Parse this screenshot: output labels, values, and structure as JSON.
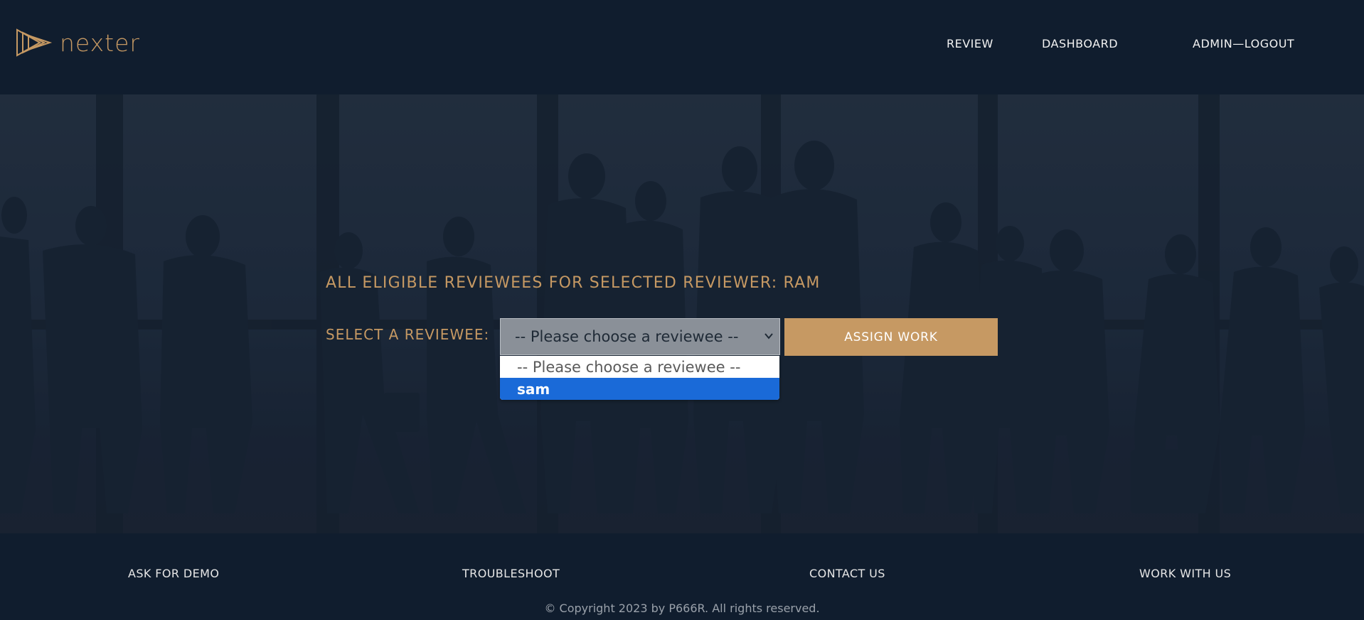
{
  "header": {
    "brand": "nexter",
    "nav": [
      {
        "label": "REVIEW"
      },
      {
        "label": "DASHBOARD"
      },
      {
        "label": "ADMIN—LOGOUT"
      }
    ]
  },
  "main": {
    "title": "ALL ELIGIBLE REVIEWEES FOR SELECTED REVIEWER: RAM",
    "select_label": "SELECT A REVIEWEE:",
    "select": {
      "value": "-- Please choose a reviewee --",
      "options": [
        {
          "label": "-- Please choose a reviewee --",
          "highlighted": false
        },
        {
          "label": "sam",
          "highlighted": true
        }
      ]
    },
    "assign_button": "ASSIGN WORK"
  },
  "footer": {
    "links": [
      {
        "label": "ASK FOR DEMO"
      },
      {
        "label": "TROUBLESHOOT"
      },
      {
        "label": "CONTACT US"
      },
      {
        "label": "WORK WITH US"
      }
    ],
    "copyright": "© Copyright 2023 by P666R. All rights reserved."
  },
  "colors": {
    "background": "#101d2e",
    "accent": "#c69963",
    "highlight": "#1a6ad8"
  }
}
